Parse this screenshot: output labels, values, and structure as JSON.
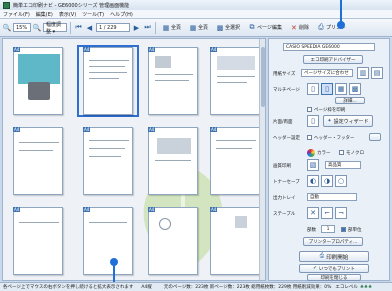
{
  "window": {
    "title": "簡単エコ印刷ナビ - GE6000シリーズ 管理画面機能"
  },
  "menu": [
    "ファイル(F)",
    "編集(E)",
    "表示(V)",
    "ツール(T)",
    "ヘルプ(H)"
  ],
  "toolbar": {
    "zoom": "15%",
    "fit": "幅度調整 ▾",
    "page_field": "1 /  229",
    "full_page": "全頁",
    "all_pages": "全頁",
    "all_list": "全選択",
    "page_setup": "ページ編集",
    "delete": "削除",
    "print": "プリント"
  },
  "pages": [
    "A4",
    "A4",
    "A4",
    "A4",
    "A4",
    "A4",
    "A4",
    "A4",
    "A4",
    "A4",
    "A4",
    "A4"
  ],
  "panel": {
    "printer": "CASIO SPEEDIA GE6000",
    "eco_button": "エコ印刷アドバイザー",
    "paper_size_label": "用紙サイズ",
    "paper_size_value": "ページサイズに合わせ",
    "multipage_label": "マルチページ",
    "detail": "詳細...",
    "page_border": "ページ枠を印刷",
    "double_side_label": "片面/両面",
    "setting_wizard": "設定ウィザード",
    "header_label": "ヘッダー設定",
    "header_footer": "ヘッダー・フッター",
    "color_label": "カラー",
    "mono_label": "モノクロ",
    "quality_label": "画質印刷",
    "quality_value": "高品質",
    "toner_label": "トナーセーブ",
    "output_label": "出力トレイ",
    "output_value": "自動",
    "staple_label": "ステープル",
    "copies_label": "部数",
    "copies_value": "1",
    "collate": "部単位",
    "print_preview": "プリンタープロパティ...",
    "print_start": "印刷開始",
    "always_print": "いつでもプリント",
    "close": "印刷を閉じる"
  },
  "status": {
    "left": "各ページ上でマウスの右ボタンを押し続けると拡大表示されます",
    "paper": "A4縦",
    "info": "元のページ数：223枚  新ページ数：223枚  総用紙枚数：229枚  用紙削減効果：0%",
    "eco": "エコレベル"
  },
  "colors": {
    "accent": "#2f6fd1",
    "page_tag": "#3f74b3",
    "watermark": "#9fcf5a"
  }
}
